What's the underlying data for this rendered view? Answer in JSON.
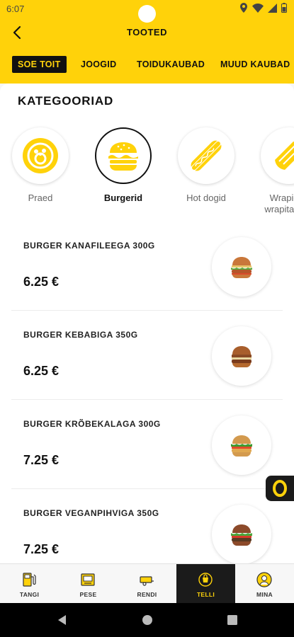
{
  "status": {
    "time": "6:07"
  },
  "header": {
    "title": "TOOTED"
  },
  "colors": {
    "brand_yellow": "#ffd20a",
    "dark": "#1b1b1b"
  },
  "tabs": [
    {
      "label": "SOE TOIT",
      "active": true
    },
    {
      "label": "JOOGID",
      "active": false
    },
    {
      "label": "TOIDUKAUBAD",
      "active": false
    },
    {
      "label": "MUUD KAUBAD",
      "active": false
    }
  ],
  "categories": {
    "title": "KATEGOORIAD",
    "items": [
      {
        "label": "Praed",
        "icon": "plate-icon",
        "active": false
      },
      {
        "label": "Burgerid",
        "icon": "burger-icon",
        "active": true
      },
      {
        "label": "Hot dogid",
        "icon": "hotdog-icon",
        "active": false
      },
      {
        "label": "Wrapid ja\nwrapitaskud",
        "icon": "wrap-icon",
        "active": false
      }
    ]
  },
  "products": [
    {
      "name": "BURGER KANAFILEEGA 300G",
      "price": "6.25 €"
    },
    {
      "name": "BURGER KEBABIGA 350G",
      "price": "6.25 €"
    },
    {
      "name": "BURGER KRÕBEKALAGA 300G",
      "price": "7.25 €"
    },
    {
      "name": "BURGER VEGANPIHVIGA 350G",
      "price": "7.25 €"
    }
  ],
  "bottom_nav": [
    {
      "label": "TANGI",
      "icon": "fuel-pump-icon",
      "active": false
    },
    {
      "label": "PESE",
      "icon": "car-wash-icon",
      "active": false
    },
    {
      "label": "RENDI",
      "icon": "trailer-icon",
      "active": false
    },
    {
      "label": "TELLI",
      "icon": "order-bag-icon",
      "active": true
    },
    {
      "label": "MINA",
      "icon": "user-icon",
      "active": false
    }
  ]
}
